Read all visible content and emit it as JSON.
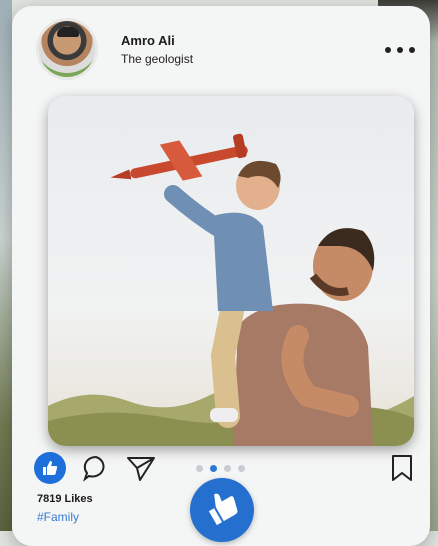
{
  "post": {
    "author": {
      "name": "Amro Ali",
      "subtitle": "The geologist"
    },
    "menu_icon": "more-horizontal-icon",
    "image_alt": "Father holding son on shoulders with toy airplane",
    "carousel": {
      "count": 4,
      "active_index": 1
    },
    "actions": {
      "like_icon": "thumbs-up-icon",
      "comment_icon": "comment-bubble-icon",
      "share_icon": "send-icon",
      "save_icon": "bookmark-icon"
    },
    "likes_text": "7819 Likes",
    "hashtag": "#Family"
  },
  "fab_icon": "thumbs-up-icon",
  "colors": {
    "accent": "#1e6fd9",
    "hashtag": "#3a7bd5",
    "card": "#f4f5f5"
  }
}
